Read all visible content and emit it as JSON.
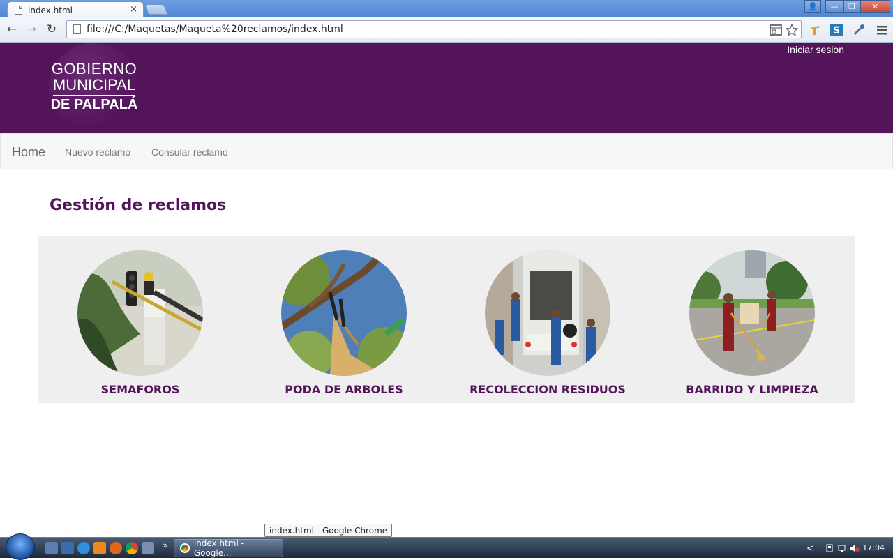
{
  "browser": {
    "tab_title": "index.html",
    "tab_close": "×",
    "url": "file:///C:/Maquetas/Maqueta%20reclamos/index.html",
    "back": "←",
    "forward": "→",
    "reload": "↻"
  },
  "window": {
    "user": "👤",
    "minimize": "—",
    "maximize": "❐",
    "close": "✕"
  },
  "header": {
    "logo_line1": "GOBIERNO",
    "logo_line2": "MUNICIPAL",
    "logo_line3": "DE PALPALÁ",
    "login_label": "Iniciar sesion",
    "bg_color": "#53145a"
  },
  "navbar": {
    "brand": "Home",
    "items": [
      {
        "label": "Nuevo reclamo"
      },
      {
        "label": "Consular reclamo"
      }
    ]
  },
  "main": {
    "title": "Gestión de reclamos",
    "cards": [
      {
        "label": "SEMAFOROS",
        "icon": "traffic-light-photo"
      },
      {
        "label": "PODA DE ARBOLES",
        "icon": "tree-pruning-photo"
      },
      {
        "label": "RECOLECCION RESIDUOS",
        "icon": "garbage-truck-photo"
      },
      {
        "label": "BARRIDO Y LIMPIEZA",
        "icon": "street-sweeping-photo"
      }
    ]
  },
  "taskbar": {
    "tooltip": "index.html - Google Chrome",
    "task_label": "index.html - Google...",
    "clock": "17:04",
    "overflow": "»",
    "tray_arrow": "<"
  }
}
